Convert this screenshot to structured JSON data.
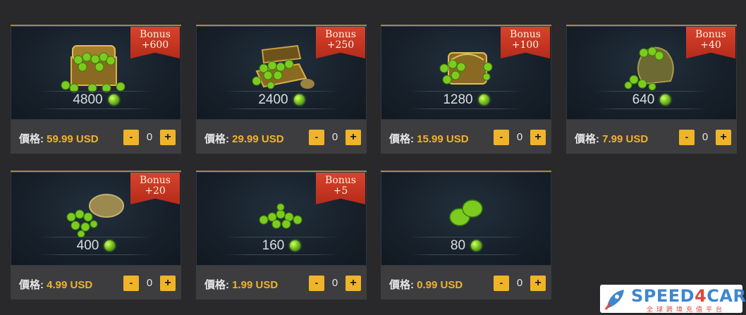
{
  "price_prefix": "價格:",
  "currency": "USD",
  "packages": [
    {
      "amount": "4800",
      "bonus_title": "Bonus",
      "bonus_value": "+600",
      "price": "59.99 USD",
      "qty": "0",
      "art": "treasure-chest"
    },
    {
      "amount": "2400",
      "bonus_title": "Bonus",
      "bonus_value": "+250",
      "price": "29.99 USD",
      "qty": "0",
      "art": "open-chest"
    },
    {
      "amount": "1280",
      "bonus_title": "Bonus",
      "bonus_value": "+100",
      "price": "15.99 USD",
      "qty": "0",
      "art": "small-chest"
    },
    {
      "amount": "640",
      "bonus_title": "Bonus",
      "bonus_value": "+40",
      "price": "7.99 USD",
      "qty": "0",
      "art": "gem-sack"
    },
    {
      "amount": "400",
      "bonus_title": "Bonus",
      "bonus_value": "+20",
      "price": "4.99 USD",
      "qty": "0",
      "art": "spilled-sack"
    },
    {
      "amount": "160",
      "bonus_title": "Bonus",
      "bonus_value": "+5",
      "price": "1.99 USD",
      "qty": "0",
      "art": "gem-pile"
    },
    {
      "amount": "80",
      "bonus_title": "",
      "bonus_value": "",
      "price": "0.99 USD",
      "qty": "0",
      "art": "two-gems"
    }
  ],
  "controls": {
    "minus": "-",
    "plus": "+"
  },
  "colors": {
    "accent": "#f0b429",
    "ribbon": "#c8341f",
    "gem": "#7ccc1f"
  },
  "watermark": {
    "name_a": "SPEED",
    "name_b": "4",
    "name_c": "CARD",
    "tagline": "全球跨境充值平台"
  }
}
